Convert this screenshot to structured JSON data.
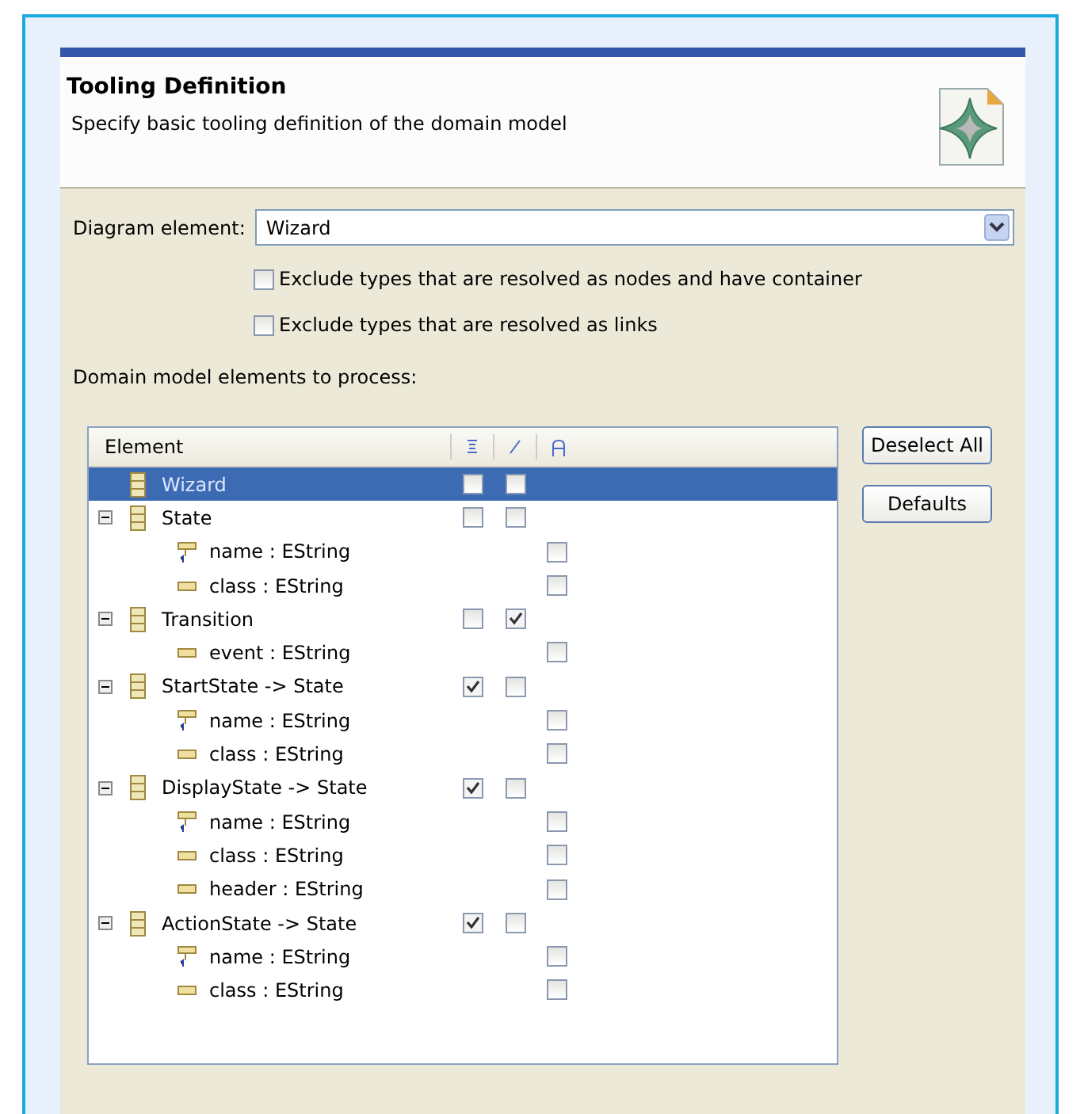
{
  "header": {
    "title": "Tooling Definition",
    "description": "Specify basic tooling definition of the domain model"
  },
  "diagram_element": {
    "label": "Diagram element:",
    "value": "Wizard"
  },
  "options": [
    {
      "label": "Exclude types that are resolved as nodes and have container",
      "checked": false
    },
    {
      "label": "Exclude types that are resolved as links",
      "checked": false
    }
  ],
  "tree_label": "Domain model elements to process:",
  "tree": {
    "column": "Element",
    "rows": [
      {
        "label": "Wizard",
        "kind": "class",
        "selected": true,
        "node": false,
        "link": false
      },
      {
        "label": "State",
        "kind": "class",
        "selected": false,
        "expanded": true,
        "node": false,
        "link": false,
        "children": [
          {
            "label": "name : EString",
            "kind": "key",
            "checked": false
          },
          {
            "label": "class : EString",
            "kind": "attribute",
            "checked": false
          }
        ]
      },
      {
        "label": "Transition",
        "kind": "class",
        "selected": false,
        "expanded": true,
        "node": false,
        "link": true,
        "children": [
          {
            "label": "event : EString",
            "kind": "attribute",
            "checked": false
          }
        ]
      },
      {
        "label": "StartState -> State",
        "kind": "class",
        "selected": false,
        "expanded": true,
        "node": true,
        "link": false,
        "children": [
          {
            "label": "name : EString",
            "kind": "key",
            "checked": false
          },
          {
            "label": "class : EString",
            "kind": "attribute",
            "checked": false
          }
        ]
      },
      {
        "label": "DisplayState -> State",
        "kind": "class",
        "selected": false,
        "expanded": true,
        "node": true,
        "link": false,
        "children": [
          {
            "label": "name : EString",
            "kind": "key",
            "checked": false
          },
          {
            "label": "class : EString",
            "kind": "attribute",
            "checked": false
          },
          {
            "label": "header : EString",
            "kind": "attribute",
            "checked": false
          }
        ]
      },
      {
        "label": "ActionState -> State",
        "kind": "class",
        "selected": false,
        "expanded": true,
        "node": true,
        "link": false,
        "children": [
          {
            "label": "name : EString",
            "kind": "key",
            "checked": false
          },
          {
            "label": "class : EString",
            "kind": "attribute",
            "checked": false
          }
        ]
      }
    ]
  },
  "buttons": [
    "Deselect All",
    "Defaults"
  ]
}
